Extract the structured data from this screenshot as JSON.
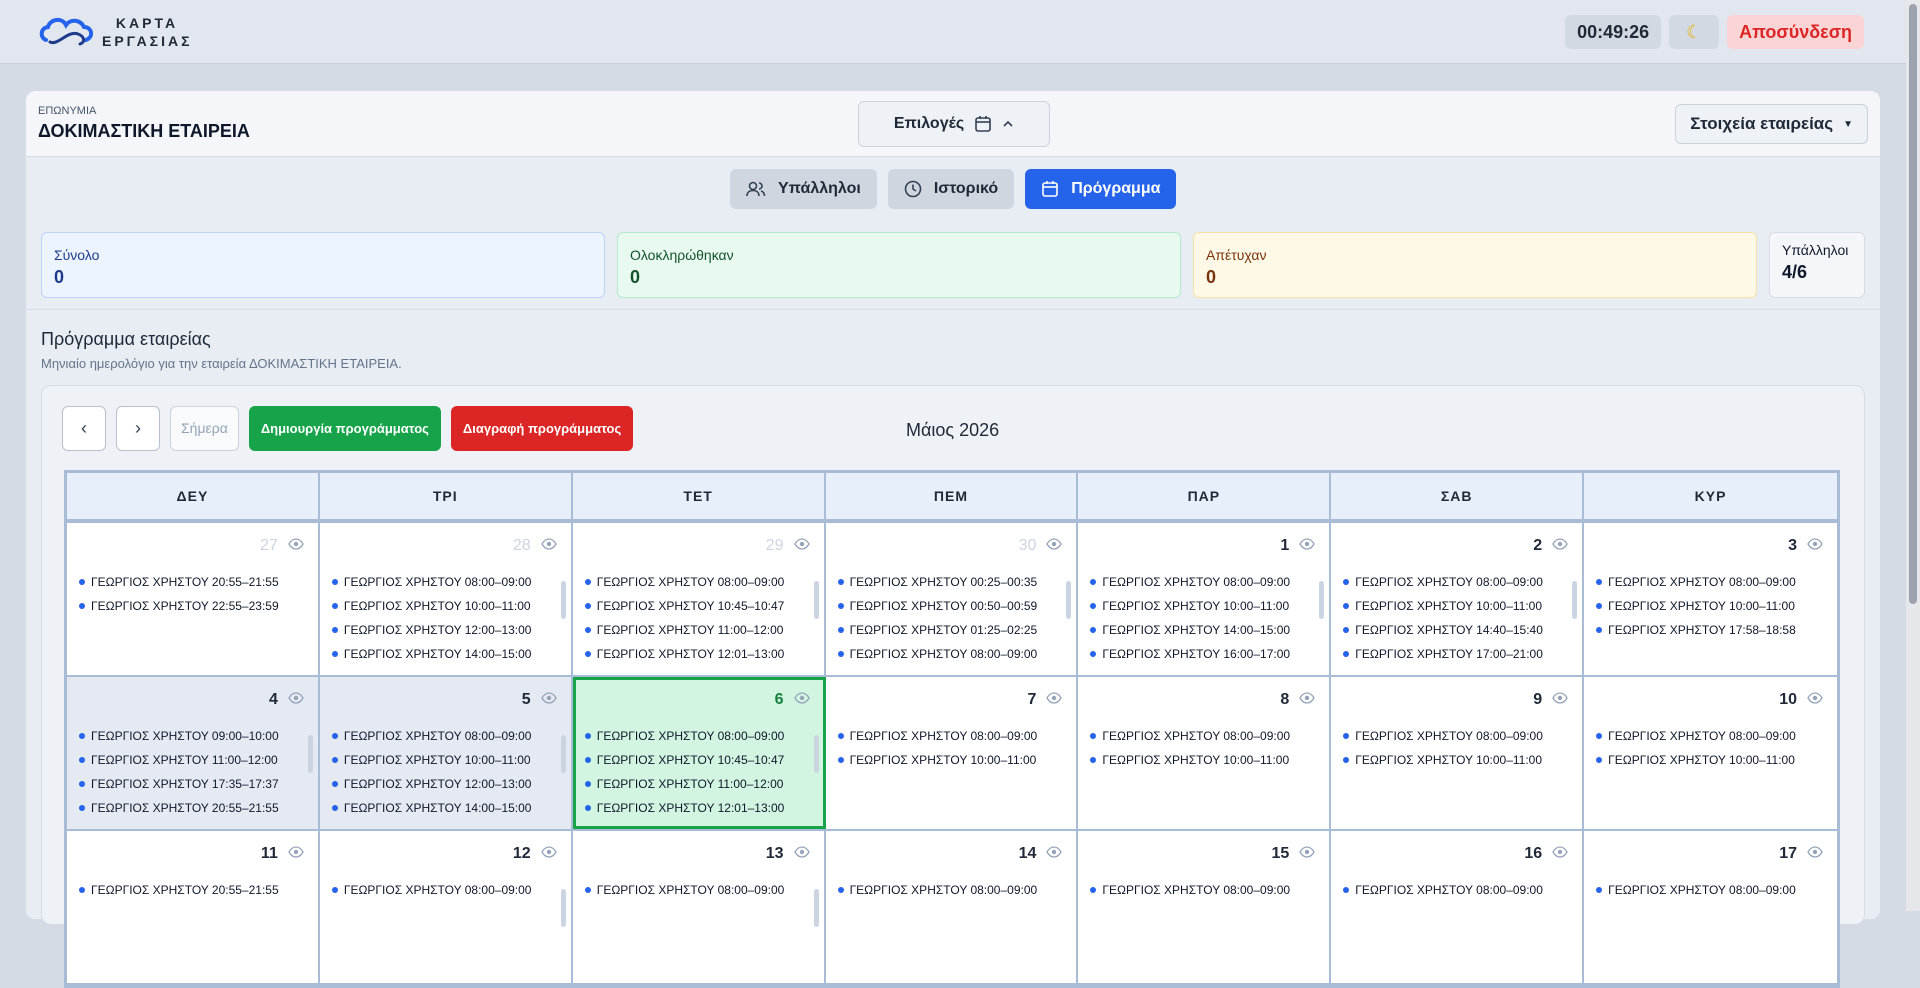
{
  "header": {
    "logo_line1": "ΚΑΡΤΑ",
    "logo_line2": "ΕΡΓΑΣΙΑΣ",
    "clock": "00:49:26",
    "logout": "Αποσύνδεση"
  },
  "company": {
    "label": "ΕΠΩΝΥΜΙΑ",
    "name": "ΔΟΚΙΜΑΣΤΙΚΗ ΕΤΑΙΡΕΙΑ",
    "options": "Επιλογές",
    "details_button": "Στοιχεία εταιρείας"
  },
  "tabs": [
    "Υπάλληλοι",
    "Ιστορικό",
    "Πρόγραμμα"
  ],
  "stats": {
    "total_label": "Σύνολο",
    "total": "0",
    "done_label": "Ολοκληρώθηκαν",
    "done": "0",
    "failed_label": "Απέτυχαν",
    "failed": "0",
    "emp_label": "Υπάλληλοι",
    "emp": "4/6"
  },
  "schedule": {
    "title": "Πρόγραμμα εταιρείας",
    "subtitle": "Μηνιαίο ημερολόγιο για την εταιρεία ΔΟΚΙΜΑΣΤΙΚΗ ΕΤΑΙΡΕΙΑ.",
    "today": "Σήμερα",
    "create": "Δημιουργία προγράμματος",
    "delete": "Διαγραφή προγράμματος",
    "month": "Μάιος 2026",
    "prev": "‹",
    "next": "›"
  },
  "weekdays": [
    "ΔΕΥ",
    "ΤΡΙ",
    "ΤΕΤ",
    "ΠΕΜ",
    "ΠΑΡ",
    "ΣΑΒ",
    "ΚΥΡ"
  ],
  "weeks": [
    [
      {
        "day": "27",
        "other": true,
        "events": [
          "ΓΕΩΡΓΙΟΣ ΧΡΗΣΤΟΥ 20:55–21:55",
          "ΓΕΩΡΓΙΟΣ ΧΡΗΣΤΟΥ 22:55–23:59"
        ]
      },
      {
        "day": "28",
        "other": true,
        "scroll": true,
        "events": [
          "ΓΕΩΡΓΙΟΣ ΧΡΗΣΤΟΥ 08:00–09:00",
          "ΓΕΩΡΓΙΟΣ ΧΡΗΣΤΟΥ 10:00–11:00",
          "ΓΕΩΡΓΙΟΣ ΧΡΗΣΤΟΥ 12:00–13:00",
          "ΓΕΩΡΓΙΟΣ ΧΡΗΣΤΟΥ 14:00–15:00"
        ]
      },
      {
        "day": "29",
        "other": true,
        "scroll": true,
        "events": [
          "ΓΕΩΡΓΙΟΣ ΧΡΗΣΤΟΥ 08:00–09:00",
          "ΓΕΩΡΓΙΟΣ ΧΡΗΣΤΟΥ 10:45–10:47",
          "ΓΕΩΡΓΙΟΣ ΧΡΗΣΤΟΥ 11:00–12:00",
          "ΓΕΩΡΓΙΟΣ ΧΡΗΣΤΟΥ 12:01–13:00"
        ]
      },
      {
        "day": "30",
        "other": true,
        "scroll": true,
        "events": [
          "ΓΕΩΡΓΙΟΣ ΧΡΗΣΤΟΥ 00:25–00:35",
          "ΓΕΩΡΓΙΟΣ ΧΡΗΣΤΟΥ 00:50–00:59",
          "ΓΕΩΡΓΙΟΣ ΧΡΗΣΤΟΥ 01:25–02:25",
          "ΓΕΩΡΓΙΟΣ ΧΡΗΣΤΟΥ 08:00–09:00"
        ]
      },
      {
        "day": "1",
        "scroll": true,
        "events": [
          "ΓΕΩΡΓΙΟΣ ΧΡΗΣΤΟΥ 08:00–09:00",
          "ΓΕΩΡΓΙΟΣ ΧΡΗΣΤΟΥ 10:00–11:00",
          "ΓΕΩΡΓΙΟΣ ΧΡΗΣΤΟΥ 14:00–15:00",
          "ΓΕΩΡΓΙΟΣ ΧΡΗΣΤΟΥ 16:00–17:00"
        ]
      },
      {
        "day": "2",
        "scroll": true,
        "events": [
          "ΓΕΩΡΓΙΟΣ ΧΡΗΣΤΟΥ 08:00–09:00",
          "ΓΕΩΡΓΙΟΣ ΧΡΗΣΤΟΥ 10:00–11:00",
          "ΓΕΩΡΓΙΟΣ ΧΡΗΣΤΟΥ 14:40–15:40",
          "ΓΕΩΡΓΙΟΣ ΧΡΗΣΤΟΥ 17:00–21:00"
        ]
      },
      {
        "day": "3",
        "events": [
          "ΓΕΩΡΓΙΟΣ ΧΡΗΣΤΟΥ 08:00–09:00",
          "ΓΕΩΡΓΙΟΣ ΧΡΗΣΤΟΥ 10:00–11:00",
          "ΓΕΩΡΓΙΟΣ ΧΡΗΣΤΟΥ 17:58–18:58"
        ]
      }
    ],
    [
      {
        "day": "4",
        "past": true,
        "scroll": true,
        "events": [
          "ΓΕΩΡΓΙΟΣ ΧΡΗΣΤΟΥ 09:00–10:00",
          "ΓΕΩΡΓΙΟΣ ΧΡΗΣΤΟΥ 11:00–12:00",
          "ΓΕΩΡΓΙΟΣ ΧΡΗΣΤΟΥ 17:35–17:37",
          "ΓΕΩΡΓΙΟΣ ΧΡΗΣΤΟΥ 20:55–21:55"
        ]
      },
      {
        "day": "5",
        "past": true,
        "scroll": true,
        "events": [
          "ΓΕΩΡΓΙΟΣ ΧΡΗΣΤΟΥ 08:00–09:00",
          "ΓΕΩΡΓΙΟΣ ΧΡΗΣΤΟΥ 10:00–11:00",
          "ΓΕΩΡΓΙΟΣ ΧΡΗΣΤΟΥ 12:00–13:00",
          "ΓΕΩΡΓΙΟΣ ΧΡΗΣΤΟΥ 14:00–15:00"
        ]
      },
      {
        "day": "6",
        "today": true,
        "scroll": true,
        "events": [
          "ΓΕΩΡΓΙΟΣ ΧΡΗΣΤΟΥ 08:00–09:00",
          "ΓΕΩΡΓΙΟΣ ΧΡΗΣΤΟΥ 10:45–10:47",
          "ΓΕΩΡΓΙΟΣ ΧΡΗΣΤΟΥ 11:00–12:00",
          "ΓΕΩΡΓΙΟΣ ΧΡΗΣΤΟΥ 12:01–13:00"
        ]
      },
      {
        "day": "7",
        "events": [
          "ΓΕΩΡΓΙΟΣ ΧΡΗΣΤΟΥ 08:00–09:00",
          "ΓΕΩΡΓΙΟΣ ΧΡΗΣΤΟΥ 10:00–11:00"
        ]
      },
      {
        "day": "8",
        "events": [
          "ΓΕΩΡΓΙΟΣ ΧΡΗΣΤΟΥ 08:00–09:00",
          "ΓΕΩΡΓΙΟΣ ΧΡΗΣΤΟΥ 10:00–11:00"
        ]
      },
      {
        "day": "9",
        "events": [
          "ΓΕΩΡΓΙΟΣ ΧΡΗΣΤΟΥ 08:00–09:00",
          "ΓΕΩΡΓΙΟΣ ΧΡΗΣΤΟΥ 10:00–11:00"
        ]
      },
      {
        "day": "10",
        "events": [
          "ΓΕΩΡΓΙΟΣ ΧΡΗΣΤΟΥ 08:00–09:00",
          "ΓΕΩΡΓΙΟΣ ΧΡΗΣΤΟΥ 10:00–11:00"
        ]
      }
    ],
    [
      {
        "day": "11",
        "events": [
          "ΓΕΩΡΓΙΟΣ ΧΡΗΣΤΟΥ 20:55–21:55"
        ]
      },
      {
        "day": "12",
        "scroll": true,
        "events": [
          "ΓΕΩΡΓΙΟΣ ΧΡΗΣΤΟΥ 08:00–09:00"
        ]
      },
      {
        "day": "13",
        "scroll": true,
        "events": [
          "ΓΕΩΡΓΙΟΣ ΧΡΗΣΤΟΥ 08:00–09:00"
        ]
      },
      {
        "day": "14",
        "events": [
          "ΓΕΩΡΓΙΟΣ ΧΡΗΣΤΟΥ 08:00–09:00"
        ]
      },
      {
        "day": "15",
        "events": [
          "ΓΕΩΡΓΙΟΣ ΧΡΗΣΤΟΥ 08:00–09:00"
        ]
      },
      {
        "day": "16",
        "events": [
          "ΓΕΩΡΓΙΟΣ ΧΡΗΣΤΟΥ 08:00–09:00"
        ]
      },
      {
        "day": "17",
        "events": [
          "ΓΕΩΡΓΙΟΣ ΧΡΗΣΤΟΥ 08:00–09:00"
        ]
      }
    ]
  ]
}
